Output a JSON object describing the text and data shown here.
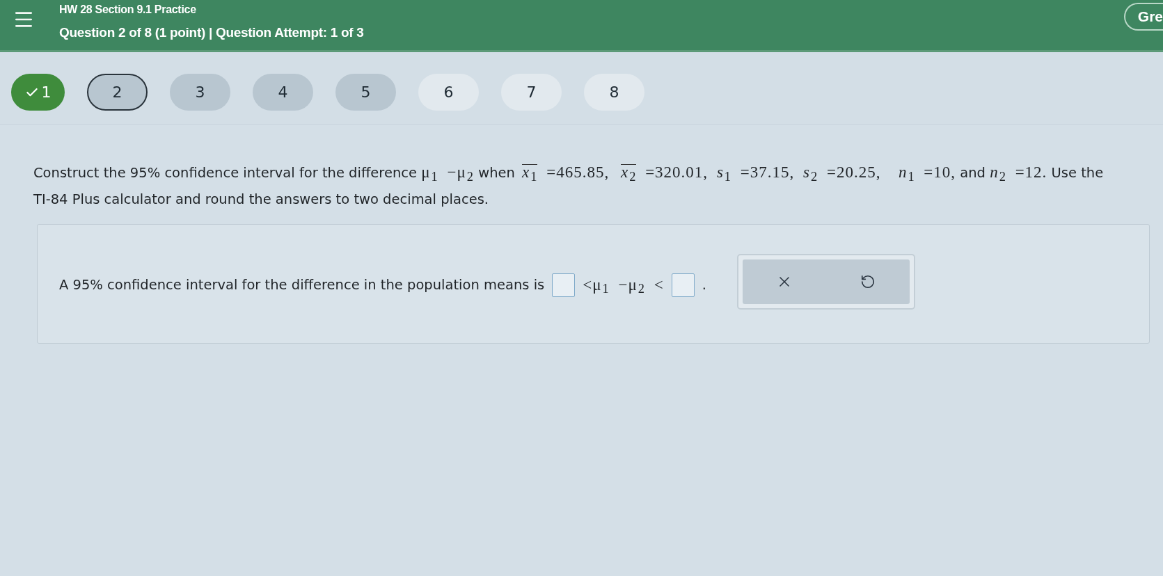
{
  "header": {
    "title": "HW 28 Section 9.1 Practice",
    "subtitle": "Question 2 of 8 (1 point) | Question Attempt: 1 of 3",
    "right_button": "Gre"
  },
  "question_nav": [
    {
      "label": "1",
      "kind": "completed",
      "selected": false
    },
    {
      "label": "2",
      "kind": "visited",
      "selected": true
    },
    {
      "label": "3",
      "kind": "visited",
      "selected": false
    },
    {
      "label": "4",
      "kind": "visited",
      "selected": false
    },
    {
      "label": "5",
      "kind": "visited",
      "selected": false
    },
    {
      "label": "6",
      "kind": "unvisited",
      "selected": false
    },
    {
      "label": "7",
      "kind": "unvisited",
      "selected": false
    },
    {
      "label": "8",
      "kind": "unvisited",
      "selected": false
    }
  ],
  "question": [
    {
      "kind": "text",
      "text": "Construct the 95% confidence interval for the difference "
    },
    {
      "kind": "math",
      "text": "μ$_{1}$ −μ$_{2}$"
    },
    {
      "kind": "text",
      "text": " when "
    },
    {
      "kind": "overline",
      "text": "*x*$_{1}$"
    },
    {
      "kind": "math",
      "text": " =465.85, "
    },
    {
      "kind": "overline",
      "text": "*x*$_{2}$"
    },
    {
      "kind": "math",
      "text": " =320.01, *s*$_{1}$ =37.15, *s*$_{2}$ =20.25,  *n*$_{1}$ =10,"
    },
    {
      "kind": "text",
      "text": " and "
    },
    {
      "kind": "math",
      "text": "*n*$_{2}$ =12."
    },
    {
      "kind": "text",
      "text": " Use the TI-84 Plus calculator and round the answers to two decimal places."
    }
  ],
  "answer": [
    {
      "kind": "text",
      "text": "A 95% confidence interval for the difference in the population means is"
    },
    {
      "kind": "input"
    },
    {
      "kind": "math",
      "text": "<μ$_{1}$ −μ$_{2}$ <"
    },
    {
      "kind": "input"
    },
    {
      "kind": "text",
      "text": "."
    }
  ],
  "tools": [
    {
      "kind": "clear"
    },
    {
      "kind": "undo"
    }
  ]
}
